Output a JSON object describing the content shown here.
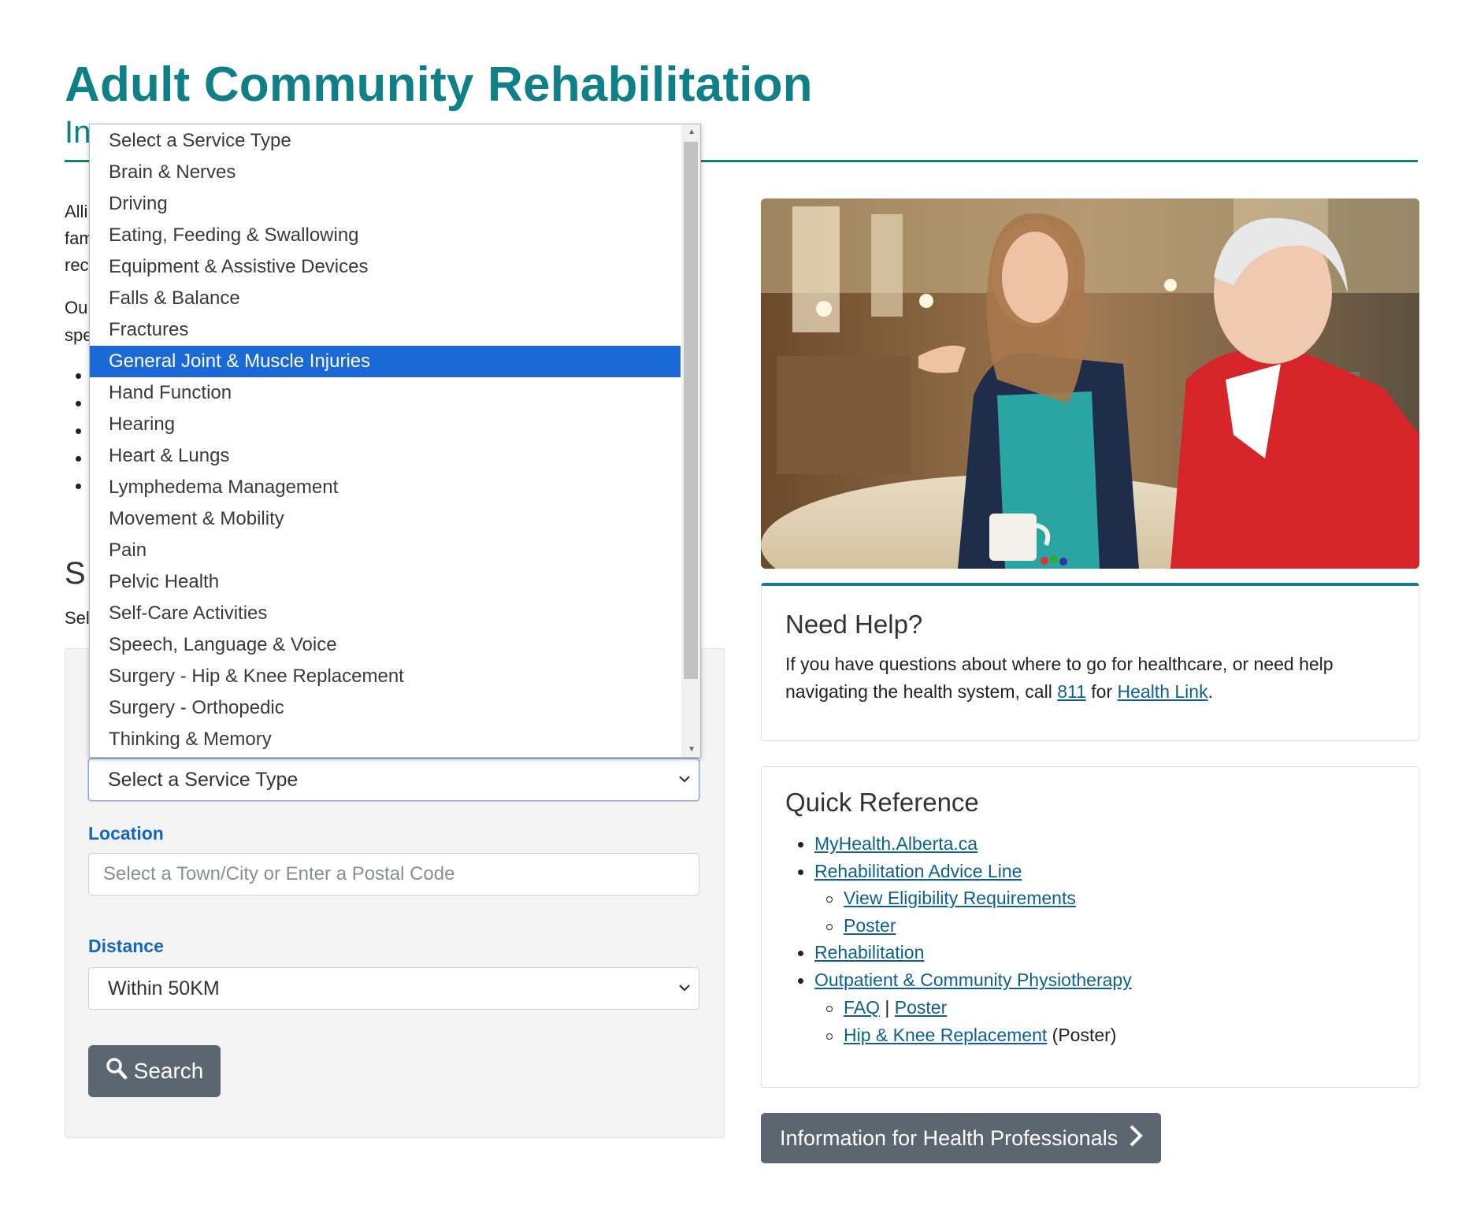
{
  "page": {
    "title": "Adult Community Rehabilitation",
    "subtitle_fragment": "In"
  },
  "intro": {
    "line_fragments": [
      "Alli",
      "fam",
      "rec"
    ],
    "second_para_fragments": [
      "Ou",
      "spe"
    ]
  },
  "search_section": {
    "title_fragment": "S",
    "desc_fragment": "Sel"
  },
  "service_type": {
    "selected_value": "Select a Service Type",
    "options": [
      "Select a Service Type",
      "Brain & Nerves",
      "Driving",
      "Eating, Feeding & Swallowing",
      "Equipment & Assistive Devices",
      "Falls & Balance",
      "Fractures",
      "General Joint & Muscle Injuries",
      "Hand Function",
      "Hearing",
      "Heart & Lungs",
      "Lymphedema Management",
      "Movement & Mobility",
      "Pain",
      "Pelvic Health",
      "Self-Care Activities",
      "Speech, Language & Voice",
      "Surgery - Hip & Knee Replacement",
      "Surgery - Orthopedic",
      "Thinking & Memory"
    ],
    "highlighted_option": "General Joint & Muscle Injuries"
  },
  "location": {
    "label": "Location",
    "placeholder": "Select a Town/City or Enter a Postal Code",
    "value": ""
  },
  "distance": {
    "label": "Distance",
    "selected_value": "Within 50KM"
  },
  "search_button": {
    "label": "Search"
  },
  "need_help": {
    "title": "Need Help?",
    "text_before": "If you have questions about where to go for healthcare, or need help navigating the health system, call ",
    "phone_link": "811",
    "text_middle": " for ",
    "health_link": "Health Link",
    "text_after": "."
  },
  "quick_reference": {
    "title": "Quick Reference",
    "items": {
      "myhealth": "MyHealth.Alberta.ca",
      "advice_line": "Rehabilitation Advice Line",
      "eligibility": "View Eligibility Requirements",
      "poster_1": "Poster",
      "rehabilitation": "Rehabilitation",
      "outpatient": "Outpatient & Community Physiotherapy",
      "faq": "FAQ",
      "separator": "|",
      "poster_2": "Poster",
      "hip_knee": "Hip & Knee Replacement",
      "hip_knee_suffix": "(Poster)"
    }
  },
  "professionals_button": {
    "label": "Information for Health Professionals"
  },
  "colors": {
    "brand_teal": "#0f8186",
    "link_blue": "#0d6190",
    "label_blue": "#1266c4",
    "highlight": "#1a69d6",
    "button_gray": "#5b6670"
  },
  "icons": [
    "search-icon",
    "chevron-down-icon",
    "chevron-right-icon"
  ]
}
